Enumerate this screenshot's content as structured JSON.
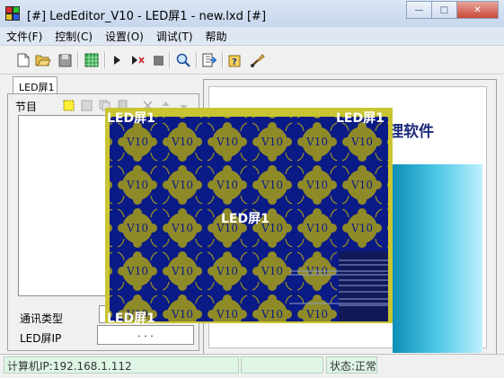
{
  "window": {
    "title": "[#] LedEditor_V10 - LED屏1 - new.lxd [#]"
  },
  "menu": [
    "文件(F)",
    "控制(C)",
    "设置(O)",
    "调试(T)",
    "帮助"
  ],
  "toolbar": {
    "buttons": [
      "new-icon",
      "open-icon",
      "save-icon",
      "screen-grid-icon",
      "play-icon",
      "step-icon",
      "stop-icon",
      "zoom-icon",
      "export-icon",
      "help-icon",
      "brush-icon"
    ]
  },
  "left_panel": {
    "tab_label": "LED屏1",
    "program_label": "节目",
    "comm_type_label": "通讯类型",
    "comm_type_value": "",
    "led_ip_label": "LED屏IP",
    "led_ip_value": ". . ."
  },
  "right_panel": {
    "bg_text": "理软件"
  },
  "led_screen": {
    "top_left_label": "LED屏1",
    "top_right_label": "LED屏1",
    "center_label": "LED屏1",
    "bottom_left_label": "LED屏1",
    "tile_text": "V10",
    "colors": {
      "border": "#c9c432",
      "background": "#0a1a86",
      "tile": "#8f8a28"
    }
  },
  "status": {
    "ip_text": "计算机IP:192.168.1.112",
    "state_text": "状态:正常"
  }
}
